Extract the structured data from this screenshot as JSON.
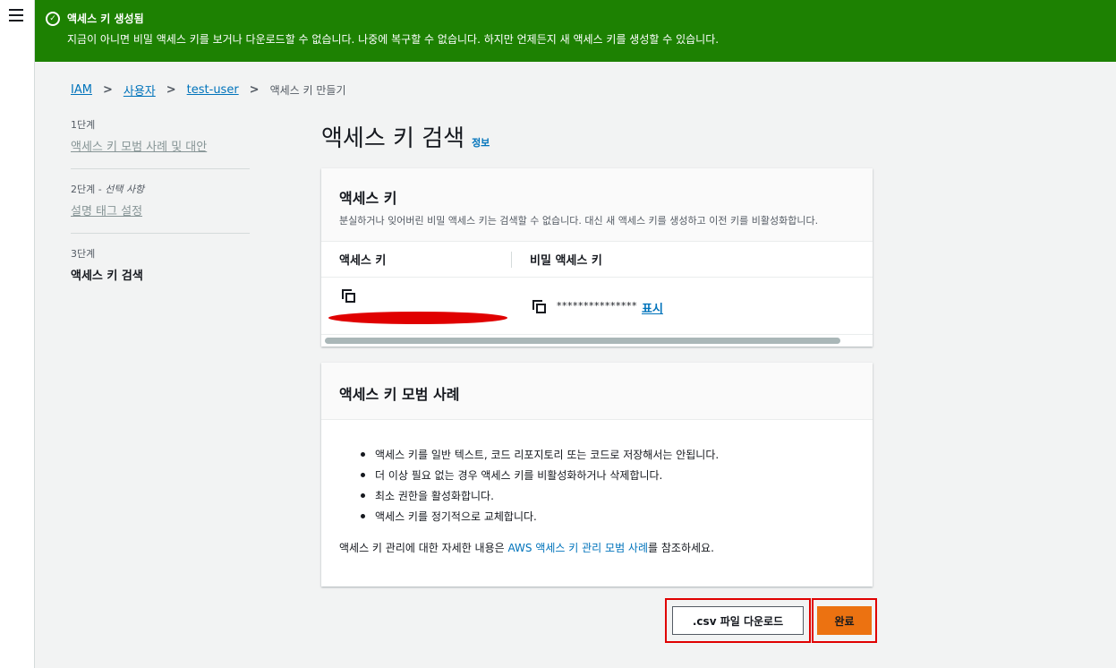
{
  "flash": {
    "title": "액세스 키 생성됨",
    "description": "지금이 아니면 비밀 액세스 키를 보거나 다운로드할 수 없습니다. 나중에 복구할 수 없습니다. 하지만 언제든지 새 액세스 키를 생성할 수 있습니다.",
    "status_color": "#1d8102"
  },
  "breadcrumb": {
    "items": [
      "IAM",
      "사용자",
      "test-user"
    ],
    "current": "액세스 키 만들기"
  },
  "steps": [
    {
      "number": "1단계",
      "optional": "",
      "label": "액세스 키 모범 사례 및 대안"
    },
    {
      "number": "2단계 - ",
      "optional": "선택 사항",
      "label": "설명 태그 설정"
    },
    {
      "number": "3단계",
      "optional": "",
      "label": "액세스 키 검색"
    }
  ],
  "page": {
    "title": "액세스 키 검색",
    "info_link": "정보"
  },
  "access_key_panel": {
    "title": "액세스 키",
    "description": "분실하거나 잊어버린 비밀 액세스 키는 검색할 수 없습니다. 대신 새 액세스 키를 생성하고 이전 키를 비활성화합니다.",
    "col_access_key": "액세스 키",
    "col_secret_key": "비밀 액세스 키",
    "secret_mask": "***************",
    "show_link": "표시"
  },
  "best_practices_panel": {
    "title": "액세스 키 모범 사례",
    "items": [
      "액세스 키를 일반 텍스트, 코드 리포지토리 또는 코드로 저장해서는 안됩니다.",
      "더 이상 필요 없는 경우 액세스 키를 비활성화하거나 삭제합니다.",
      "최소 권한을 활성화합니다.",
      "액세스 키를 정기적으로 교체합니다."
    ],
    "note_prefix": "액세스 키 관리에 대한 자세한 내용은 ",
    "note_link": "AWS 액세스 키 관리 모범 사례",
    "note_suffix": "를 참조하세요."
  },
  "actions": {
    "download_csv": ".csv 파일 다운로드",
    "done": "완료"
  },
  "colors": {
    "primary": "#ec7211",
    "link": "#0073bb",
    "highlight": "#e00000"
  }
}
